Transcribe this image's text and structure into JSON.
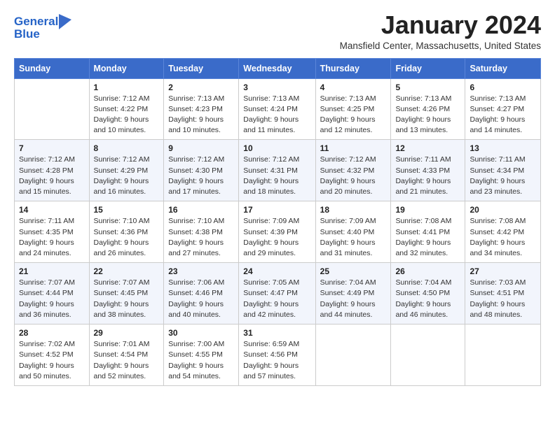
{
  "header": {
    "logo_line1": "General",
    "logo_line2": "Blue",
    "month": "January 2024",
    "location": "Mansfield Center, Massachusetts, United States"
  },
  "days_of_week": [
    "Sunday",
    "Monday",
    "Tuesday",
    "Wednesday",
    "Thursday",
    "Friday",
    "Saturday"
  ],
  "weeks": [
    [
      {
        "day": "",
        "info": ""
      },
      {
        "day": "1",
        "info": "Sunrise: 7:12 AM\nSunset: 4:22 PM\nDaylight: 9 hours\nand 10 minutes."
      },
      {
        "day": "2",
        "info": "Sunrise: 7:13 AM\nSunset: 4:23 PM\nDaylight: 9 hours\nand 10 minutes."
      },
      {
        "day": "3",
        "info": "Sunrise: 7:13 AM\nSunset: 4:24 PM\nDaylight: 9 hours\nand 11 minutes."
      },
      {
        "day": "4",
        "info": "Sunrise: 7:13 AM\nSunset: 4:25 PM\nDaylight: 9 hours\nand 12 minutes."
      },
      {
        "day": "5",
        "info": "Sunrise: 7:13 AM\nSunset: 4:26 PM\nDaylight: 9 hours\nand 13 minutes."
      },
      {
        "day": "6",
        "info": "Sunrise: 7:13 AM\nSunset: 4:27 PM\nDaylight: 9 hours\nand 14 minutes."
      }
    ],
    [
      {
        "day": "7",
        "info": "Sunrise: 7:12 AM\nSunset: 4:28 PM\nDaylight: 9 hours\nand 15 minutes."
      },
      {
        "day": "8",
        "info": "Sunrise: 7:12 AM\nSunset: 4:29 PM\nDaylight: 9 hours\nand 16 minutes."
      },
      {
        "day": "9",
        "info": "Sunrise: 7:12 AM\nSunset: 4:30 PM\nDaylight: 9 hours\nand 17 minutes."
      },
      {
        "day": "10",
        "info": "Sunrise: 7:12 AM\nSunset: 4:31 PM\nDaylight: 9 hours\nand 18 minutes."
      },
      {
        "day": "11",
        "info": "Sunrise: 7:12 AM\nSunset: 4:32 PM\nDaylight: 9 hours\nand 20 minutes."
      },
      {
        "day": "12",
        "info": "Sunrise: 7:11 AM\nSunset: 4:33 PM\nDaylight: 9 hours\nand 21 minutes."
      },
      {
        "day": "13",
        "info": "Sunrise: 7:11 AM\nSunset: 4:34 PM\nDaylight: 9 hours\nand 23 minutes."
      }
    ],
    [
      {
        "day": "14",
        "info": "Sunrise: 7:11 AM\nSunset: 4:35 PM\nDaylight: 9 hours\nand 24 minutes."
      },
      {
        "day": "15",
        "info": "Sunrise: 7:10 AM\nSunset: 4:36 PM\nDaylight: 9 hours\nand 26 minutes."
      },
      {
        "day": "16",
        "info": "Sunrise: 7:10 AM\nSunset: 4:38 PM\nDaylight: 9 hours\nand 27 minutes."
      },
      {
        "day": "17",
        "info": "Sunrise: 7:09 AM\nSunset: 4:39 PM\nDaylight: 9 hours\nand 29 minutes."
      },
      {
        "day": "18",
        "info": "Sunrise: 7:09 AM\nSunset: 4:40 PM\nDaylight: 9 hours\nand 31 minutes."
      },
      {
        "day": "19",
        "info": "Sunrise: 7:08 AM\nSunset: 4:41 PM\nDaylight: 9 hours\nand 32 minutes."
      },
      {
        "day": "20",
        "info": "Sunrise: 7:08 AM\nSunset: 4:42 PM\nDaylight: 9 hours\nand 34 minutes."
      }
    ],
    [
      {
        "day": "21",
        "info": "Sunrise: 7:07 AM\nSunset: 4:44 PM\nDaylight: 9 hours\nand 36 minutes."
      },
      {
        "day": "22",
        "info": "Sunrise: 7:07 AM\nSunset: 4:45 PM\nDaylight: 9 hours\nand 38 minutes."
      },
      {
        "day": "23",
        "info": "Sunrise: 7:06 AM\nSunset: 4:46 PM\nDaylight: 9 hours\nand 40 minutes."
      },
      {
        "day": "24",
        "info": "Sunrise: 7:05 AM\nSunset: 4:47 PM\nDaylight: 9 hours\nand 42 minutes."
      },
      {
        "day": "25",
        "info": "Sunrise: 7:04 AM\nSunset: 4:49 PM\nDaylight: 9 hours\nand 44 minutes."
      },
      {
        "day": "26",
        "info": "Sunrise: 7:04 AM\nSunset: 4:50 PM\nDaylight: 9 hours\nand 46 minutes."
      },
      {
        "day": "27",
        "info": "Sunrise: 7:03 AM\nSunset: 4:51 PM\nDaylight: 9 hours\nand 48 minutes."
      }
    ],
    [
      {
        "day": "28",
        "info": "Sunrise: 7:02 AM\nSunset: 4:52 PM\nDaylight: 9 hours\nand 50 minutes."
      },
      {
        "day": "29",
        "info": "Sunrise: 7:01 AM\nSunset: 4:54 PM\nDaylight: 9 hours\nand 52 minutes."
      },
      {
        "day": "30",
        "info": "Sunrise: 7:00 AM\nSunset: 4:55 PM\nDaylight: 9 hours\nand 54 minutes."
      },
      {
        "day": "31",
        "info": "Sunrise: 6:59 AM\nSunset: 4:56 PM\nDaylight: 9 hours\nand 57 minutes."
      },
      {
        "day": "",
        "info": ""
      },
      {
        "day": "",
        "info": ""
      },
      {
        "day": "",
        "info": ""
      }
    ]
  ]
}
